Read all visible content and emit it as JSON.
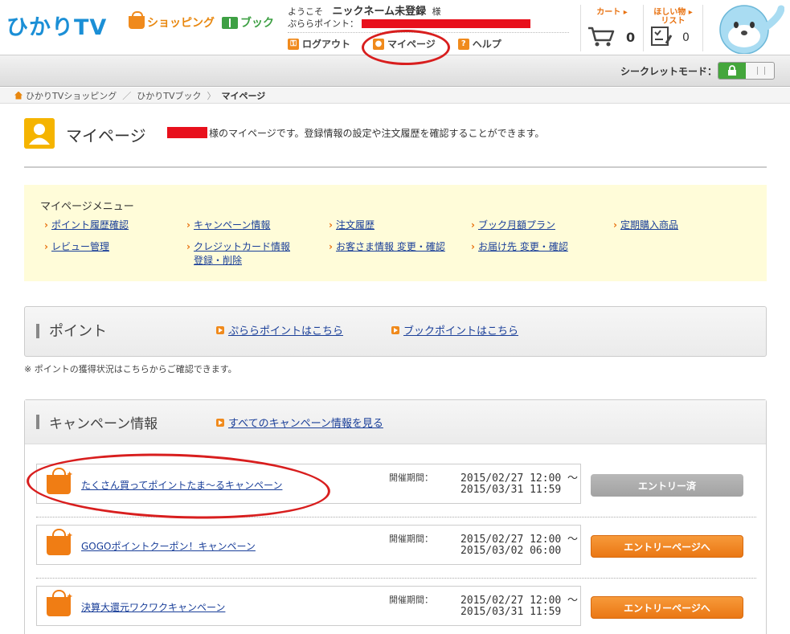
{
  "header": {
    "logo_main": "ひかりTV",
    "logo_shopping": "ショッピング",
    "logo_book": "ブック",
    "welcome_prefix": "ようこそ",
    "nickname": "ニックネーム未登録",
    "welcome_suffix": "様",
    "points_label": "ぷららポイント：",
    "links": {
      "logout": "ログアウト",
      "mypage": "マイページ",
      "help": "ヘルプ"
    },
    "cart": {
      "label": "カート",
      "count": "0"
    },
    "wishlist": {
      "label_line1": "ほしい物",
      "label_line2": "リスト",
      "count": "0"
    }
  },
  "secret_mode": {
    "label": "シークレットモード："
  },
  "breadcrumb": {
    "items": [
      "ひかりTVショッピング",
      "ひかりTVブック"
    ],
    "separator": "／",
    "current": "マイページ"
  },
  "page": {
    "title": "マイページ",
    "description": "様のマイページです。登録情報の設定や注文履歴を確認することができます。"
  },
  "menu": {
    "title": "マイページメニュー",
    "items": [
      "ポイント履歴確認",
      "キャンペーン情報",
      "注文履歴",
      "ブック月額プラン",
      "定期購入商品",
      "レビュー管理",
      "クレジットカード情報",
      "登録・削除",
      "お客さま情報 変更・確認",
      "お届け先 変更・確認"
    ]
  },
  "points_section": {
    "title": "ポイント",
    "link_plala": "ぷららポイントはこちら",
    "link_book": "ブックポイントはこちら",
    "note": "※ ポイントの獲得状況はこちらからご確認できます。"
  },
  "campaign_section": {
    "title": "キャンペーン情報",
    "see_all": "すべてのキャンペーン情報を見る",
    "period_label": "開催期間：",
    "campaigns": [
      {
        "name": "たくさん買ってポイントたま～るキャンペーン",
        "start": "2015/02/27 12:00 ～",
        "end": "2015/03/31 11:59",
        "button": "エントリー済"
      },
      {
        "name": "GOGOポイントクーポン！キャンペーン",
        "start": "2015/02/27 12:00 ～",
        "end": "2015/03/02 06:00",
        "button": "エントリーページへ"
      },
      {
        "name": "決算大還元ワクワクキャンペーン",
        "start": "2015/02/27 12:00 ～",
        "end": "2015/03/31 11:59",
        "button": "エントリーページへ"
      }
    ]
  },
  "colors": {
    "brand_blue": "#1b8fd6",
    "brand_orange": "#f08a1c",
    "link": "#1a3f99",
    "menu_bg": "#fffcd9",
    "annotation_red": "#d81e1e",
    "redaction_red": "#e8101c"
  }
}
